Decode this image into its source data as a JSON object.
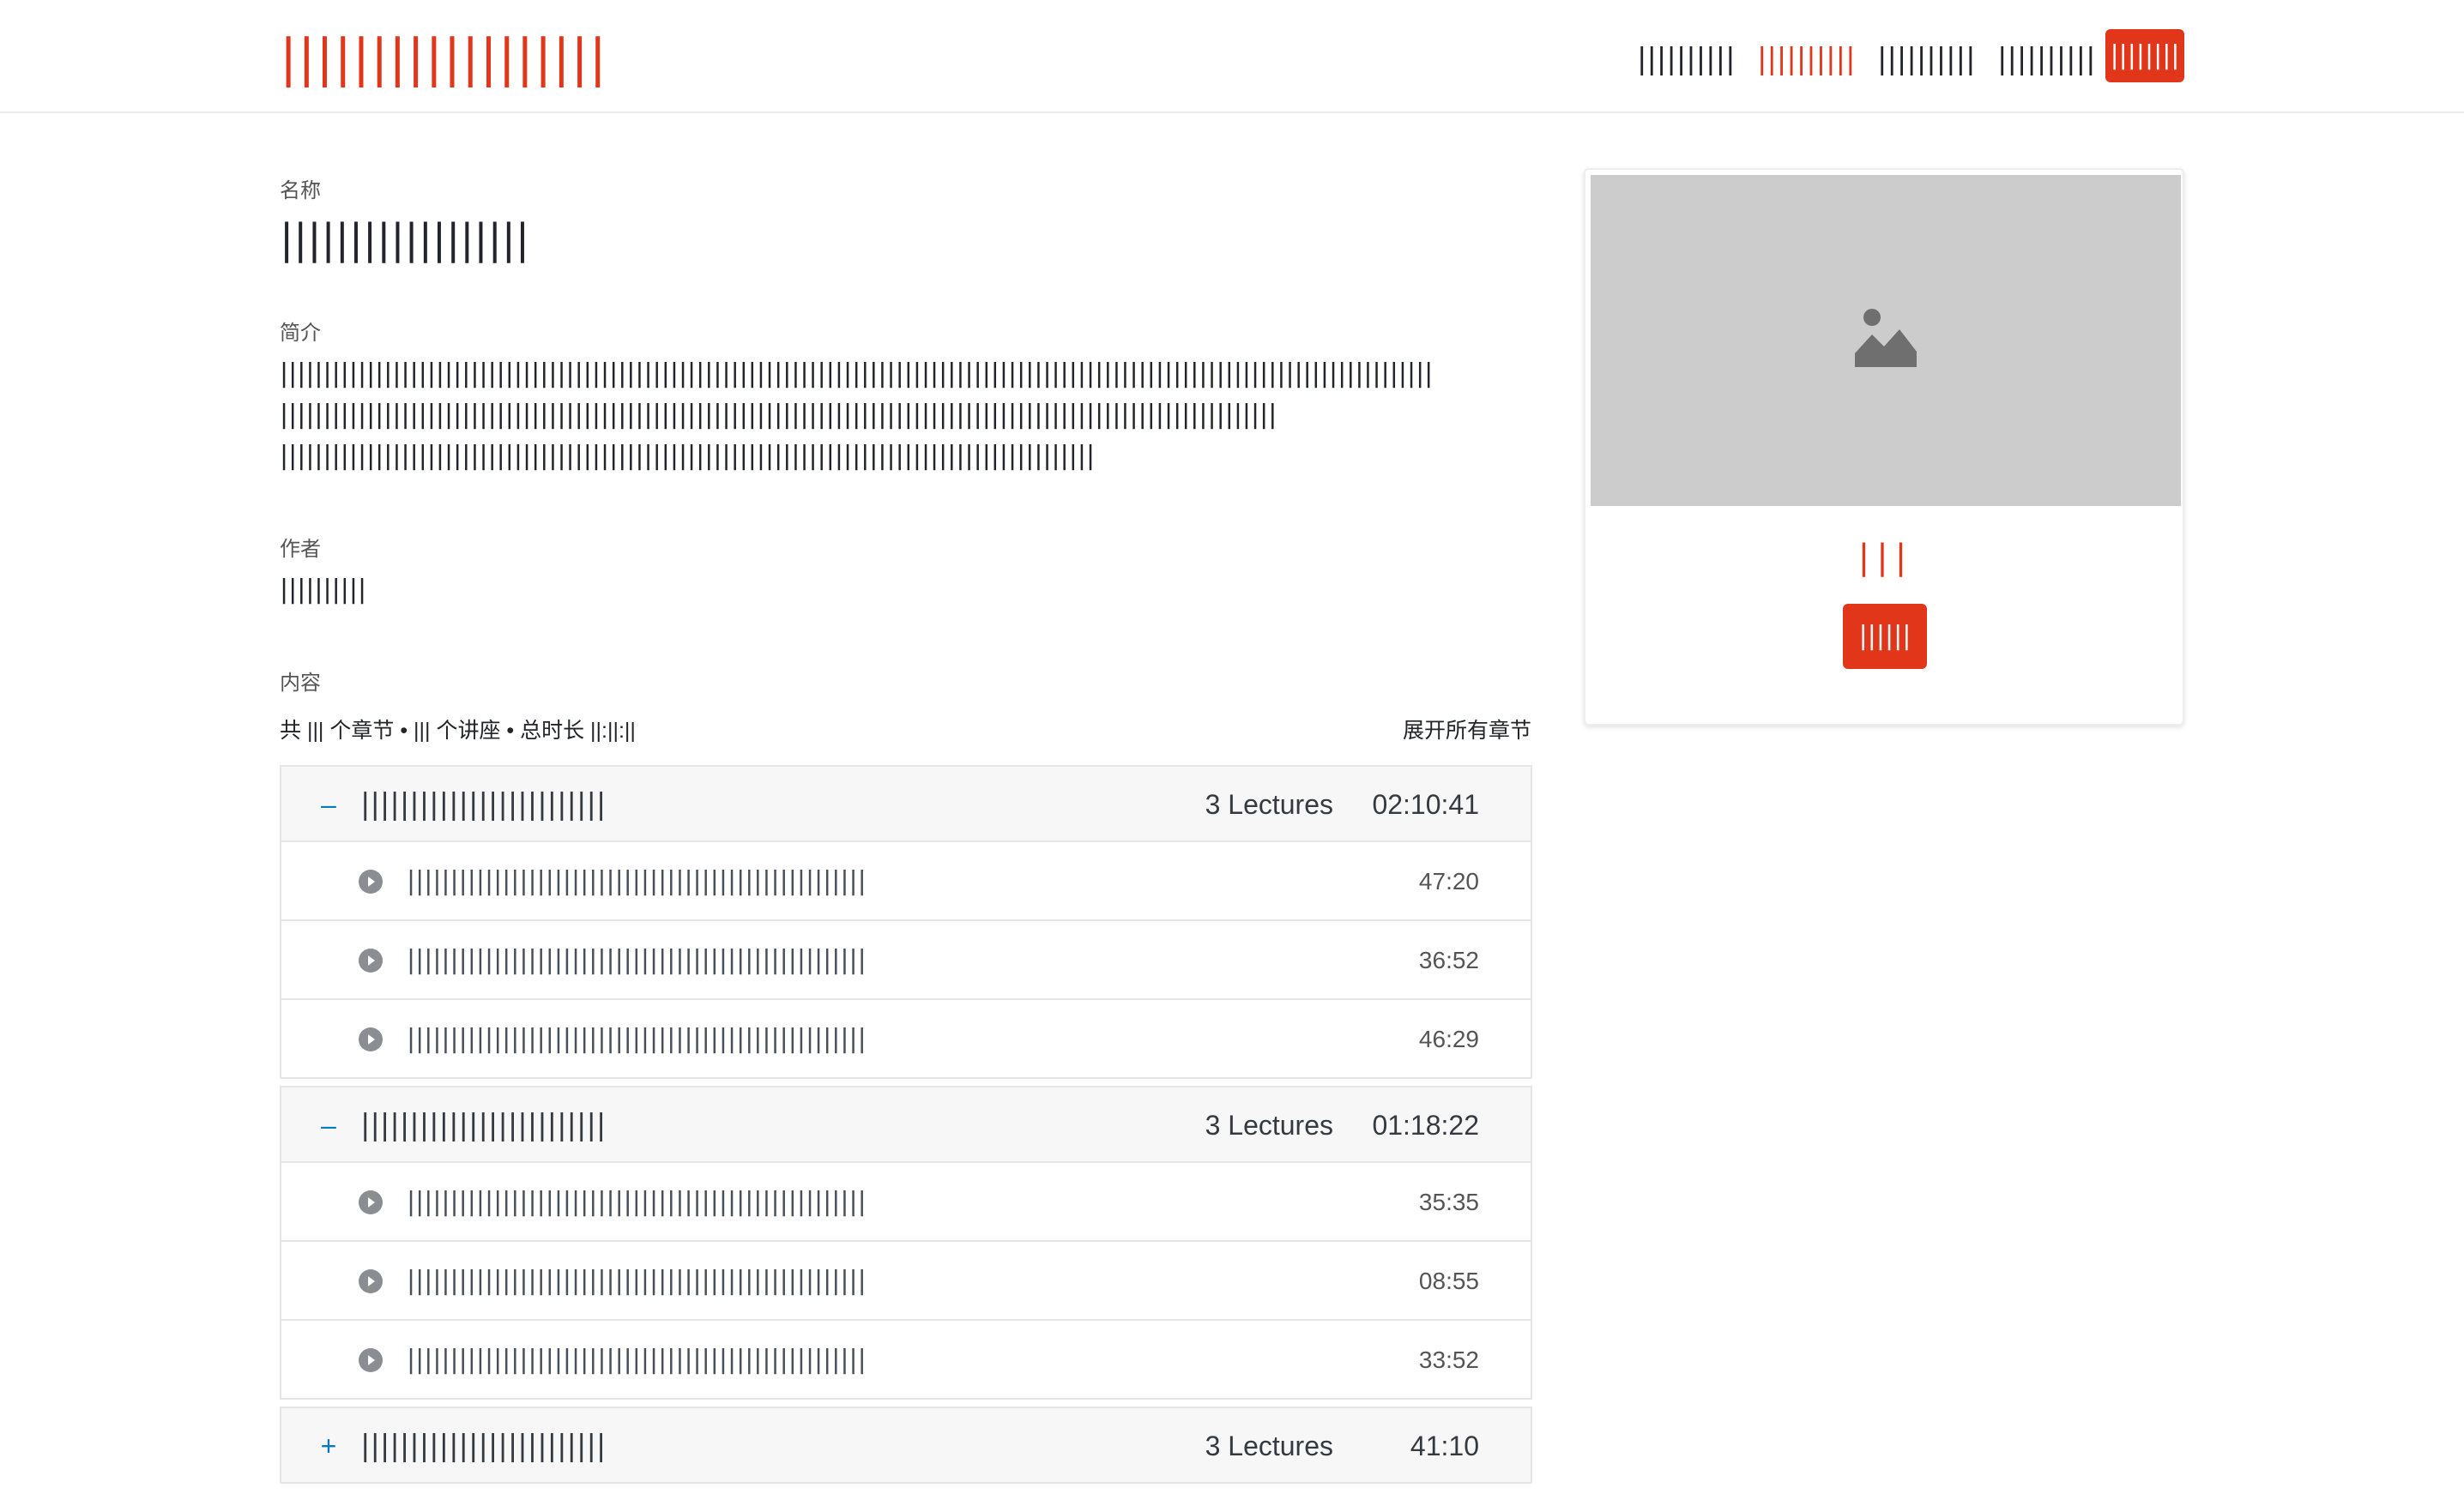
{
  "header": {
    "logo": "||||||||||||||||||",
    "nav": [
      {
        "label": "||||||||||"
      },
      {
        "label": "||||||||||"
      },
      {
        "label": "||||||||||"
      },
      {
        "label": "||||||||||"
      }
    ],
    "nav_button": "||||||||",
    "accent_color": "#e2361b"
  },
  "course": {
    "name_label": "名称",
    "name": "||||||||||||||||||",
    "intro_label": "简介",
    "intro_lines": [
      "|||||||||||||||||||||||||||||||||||||||||||||||||||||||||||||||||||||||||||||||||||||||||||||||||||||||||||||||||||||||||||||||||||||",
      "|||||||||||||||||||||||||||||||||||||||||||||||||||||||||||||||||||||||||||||||||||||||||||||||||||||||||||||||||||",
      "||||||||||||||||||||||||||||||||||||||||||||||||||||||||||||||||||||||||||||||||||||||||||||||"
    ],
    "author_label": "作者",
    "author": "||||||||||",
    "content_label": "内容",
    "summary": "共 ||| 个章节 • ||| 个讲座 • 总时长 ||:||:||",
    "expand_all": "展开所有章节"
  },
  "sections": [
    {
      "toggle": "–",
      "title": "|||||||||||||||||||||||||",
      "count": "3 Lectures",
      "duration": "02:10:41",
      "lectures": [
        {
          "title": "|||||||||||||||||||||||||||||||||||||||||||||||||||||",
          "duration": "47:20"
        },
        {
          "title": "|||||||||||||||||||||||||||||||||||||||||||||||||||||",
          "duration": "36:52"
        },
        {
          "title": "|||||||||||||||||||||||||||||||||||||||||||||||||||||",
          "duration": "46:29"
        }
      ]
    },
    {
      "toggle": "–",
      "title": "|||||||||||||||||||||||||",
      "count": "3 Lectures",
      "duration": "01:18:22",
      "lectures": [
        {
          "title": "|||||||||||||||||||||||||||||||||||||||||||||||||||||",
          "duration": "35:35"
        },
        {
          "title": "|||||||||||||||||||||||||||||||||||||||||||||||||||||",
          "duration": "08:55"
        },
        {
          "title": "|||||||||||||||||||||||||||||||||||||||||||||||||||||",
          "duration": "33:52"
        }
      ]
    },
    {
      "toggle": "+",
      "title": "|||||||||||||||||||||||||",
      "count": "3 Lectures",
      "duration": "41:10",
      "lectures": []
    }
  ],
  "card": {
    "image_icon": "image-placeholder-icon",
    "price": "|||",
    "buy_button": "||||||"
  }
}
